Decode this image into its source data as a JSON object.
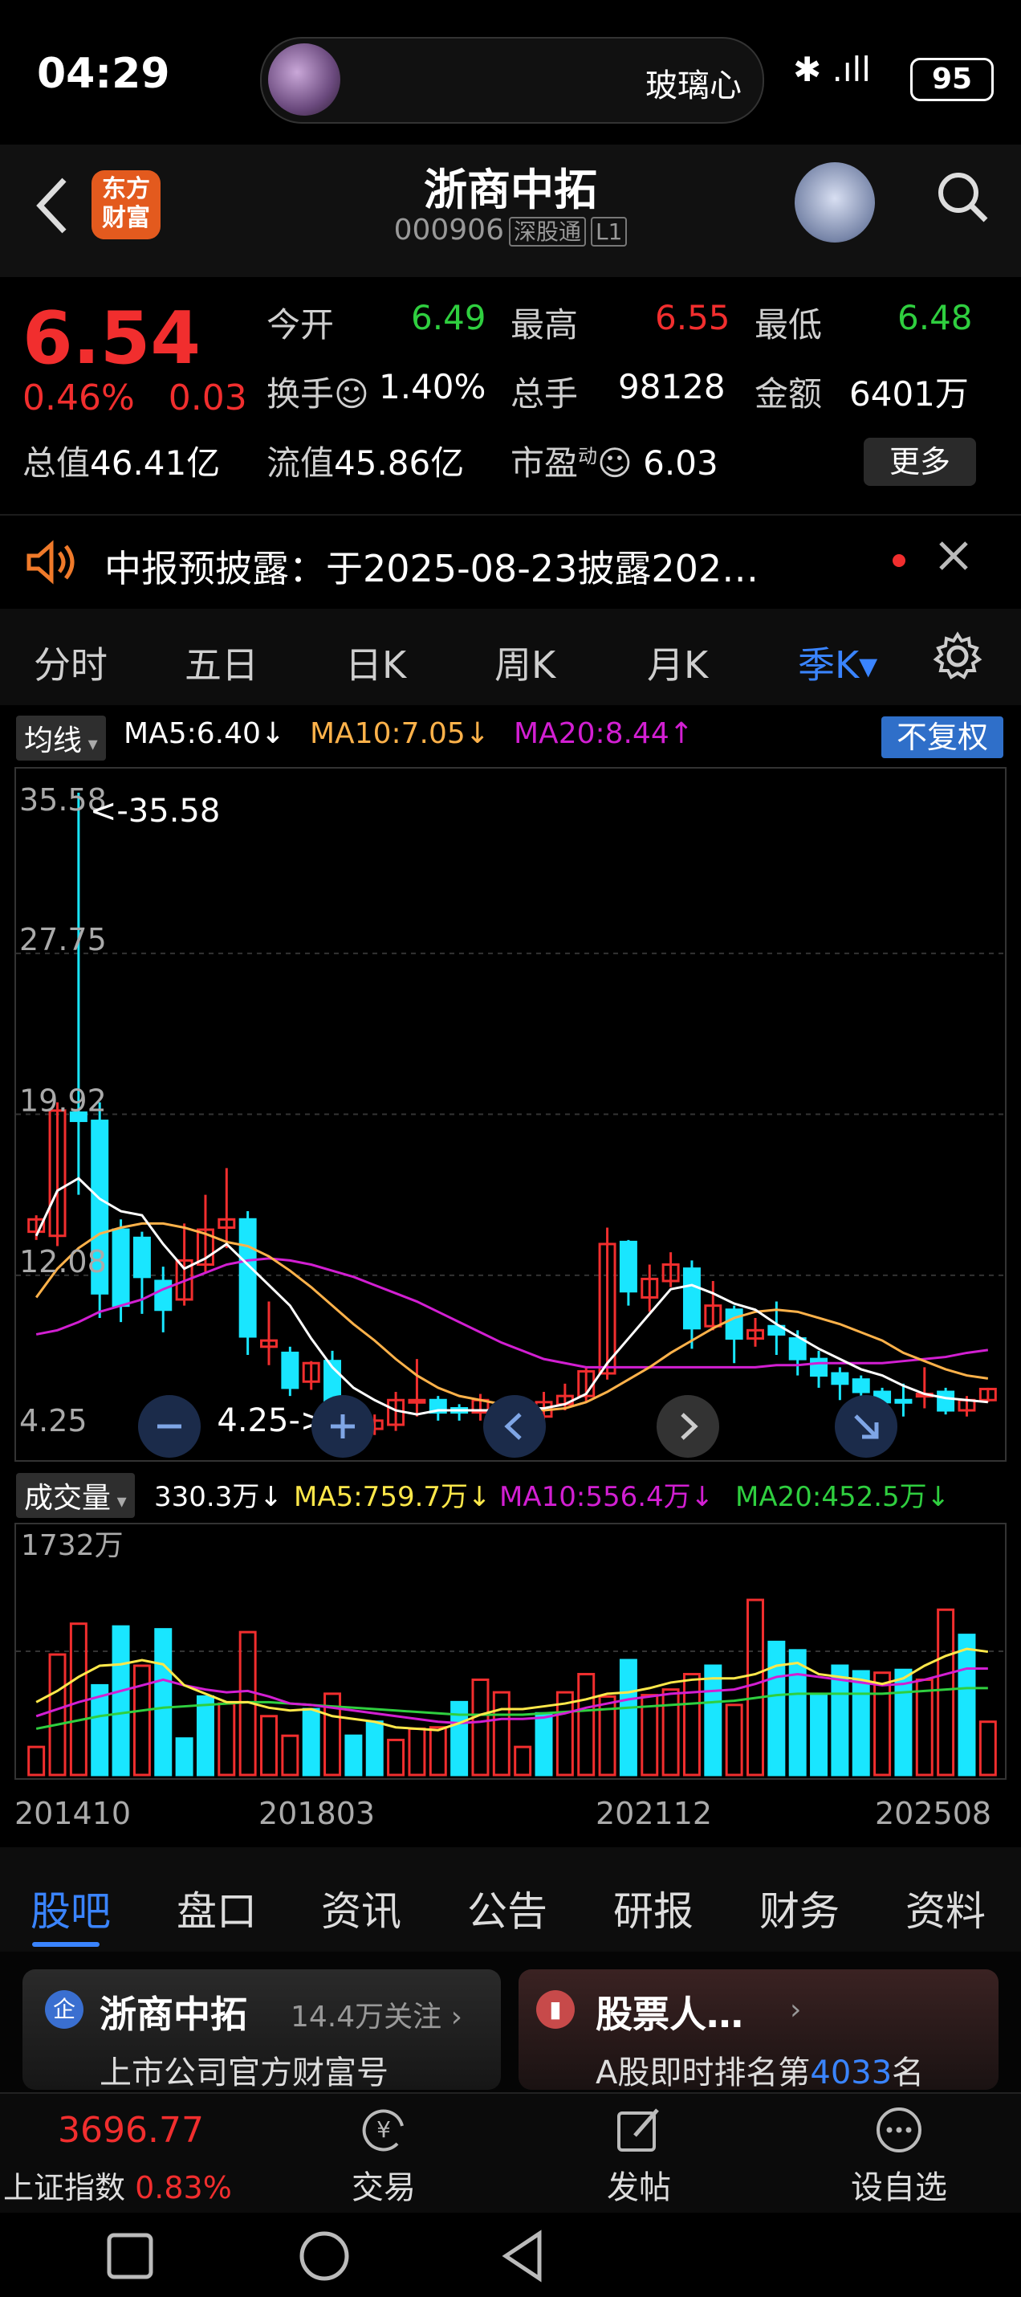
{
  "status_bar": {
    "time": "04:29",
    "island_text": "玻璃心",
    "signal_icons": "✱ .ıll",
    "battery": "95"
  },
  "header": {
    "back_icon": "chevron-left-icon",
    "logo_line1": "东方",
    "logo_line2": "财富",
    "stock_name": "浙商中拓",
    "stock_code": "000906",
    "exchange_tag": "深股通",
    "level_tag": "L1"
  },
  "quote": {
    "price": "6.54",
    "change_pct": "0.46%",
    "change_amt": "0.03",
    "open_label": "今开",
    "open": "6.49",
    "high_label": "最高",
    "high": "6.55",
    "low_label": "最低",
    "low": "6.48",
    "turnover_label": "换手",
    "turnover": "1.40%",
    "volume_label": "总手",
    "volume": "98128",
    "amount_label": "金额",
    "amount": "6401万",
    "total_cap_label": "总值",
    "total_cap": "46.41亿",
    "float_cap_label": "流值",
    "float_cap": "45.86亿",
    "pe_label": "市盈",
    "pe_sup": "动",
    "pe": "6.03",
    "more_button": "更多"
  },
  "notice": {
    "text": "中报预披露：于2025-08-23披露202…"
  },
  "kline_tabs": [
    "分时",
    "五日",
    "日K",
    "周K",
    "月K",
    "季K▾"
  ],
  "kline_active": 5,
  "ma_row": {
    "selector": "均线",
    "ma5": "MA5:6.40↓",
    "ma10": "MA10:7.05↓",
    "ma20": "MA20:8.44↑",
    "adjust": "不复权"
  },
  "chart_data": [
    {
      "type": "candlestick",
      "title": "",
      "y_ticks": [
        "35.58",
        "27.75",
        "19.92",
        "12.08",
        "4.25"
      ],
      "ylim": [
        4.25,
        35.58
      ],
      "max_label": "<-35.58",
      "min_label": "4.25->",
      "series_colors": {
        "up": "#f12e2e",
        "down": "#19e6ff",
        "ma5": "#ffffff",
        "ma10": "#ffb24a",
        "ma20": "#d21fd2"
      },
      "candles": [
        {
          "o": 14.2,
          "c": 14.8,
          "h": 15.0,
          "l": 13.8
        },
        {
          "o": 14.0,
          "c": 20.1,
          "h": 20.5,
          "l": 13.5
        },
        {
          "o": 20.0,
          "c": 19.6,
          "h": 35.58,
          "l": 16.0
        },
        {
          "o": 19.6,
          "c": 11.2,
          "h": 20.5,
          "l": 10.0
        },
        {
          "o": 14.3,
          "c": 10.6,
          "h": 14.8,
          "l": 9.8
        },
        {
          "o": 13.9,
          "c": 12.0,
          "h": 14.2,
          "l": 10.2
        },
        {
          "o": 11.8,
          "c": 10.4,
          "h": 12.5,
          "l": 9.3
        },
        {
          "o": 10.9,
          "c": 12.8,
          "h": 14.6,
          "l": 10.6
        },
        {
          "o": 12.6,
          "c": 14.3,
          "h": 16.0,
          "l": 12.2
        },
        {
          "o": 14.4,
          "c": 14.8,
          "h": 17.3,
          "l": 13.4
        },
        {
          "o": 14.8,
          "c": 9.1,
          "h": 15.2,
          "l": 8.2
        },
        {
          "o": 8.6,
          "c": 8.9,
          "h": 10.8,
          "l": 7.7
        },
        {
          "o": 8.3,
          "c": 6.6,
          "h": 8.6,
          "l": 6.2
        },
        {
          "o": 6.9,
          "c": 7.8,
          "h": 7.9,
          "l": 6.5
        },
        {
          "o": 7.9,
          "c": 5.0,
          "h": 8.4,
          "l": 4.6
        },
        {
          "o": 5.0,
          "c": 4.5,
          "h": 5.3,
          "l": 4.25
        },
        {
          "o": 4.6,
          "c": 5.0,
          "h": 5.3,
          "l": 4.3
        },
        {
          "o": 4.8,
          "c": 6.0,
          "h": 6.4,
          "l": 4.5
        },
        {
          "o": 6.0,
          "c": 6.0,
          "h": 8.0,
          "l": 5.2
        },
        {
          "o": 6.0,
          "c": 5.4,
          "h": 6.2,
          "l": 5.0
        },
        {
          "o": 5.6,
          "c": 5.4,
          "h": 5.8,
          "l": 5.0
        },
        {
          "o": 5.4,
          "c": 6.0,
          "h": 6.3,
          "l": 5.0
        },
        {
          "o": 5.5,
          "c": 4.7,
          "h": 5.7,
          "l": 4.5
        },
        {
          "o": 4.7,
          "c": 5.3,
          "h": 5.5,
          "l": 4.6
        },
        {
          "o": 5.2,
          "c": 5.9,
          "h": 6.4,
          "l": 5.0
        },
        {
          "o": 5.8,
          "c": 6.2,
          "h": 6.8,
          "l": 5.5
        },
        {
          "o": 6.2,
          "c": 7.4,
          "h": 7.6,
          "l": 5.9
        },
        {
          "o": 7.3,
          "c": 13.6,
          "h": 14.4,
          "l": 7.0
        },
        {
          "o": 13.7,
          "c": 11.3,
          "h": 13.8,
          "l": 10.6
        },
        {
          "o": 11.0,
          "c": 11.9,
          "h": 12.6,
          "l": 10.3
        },
        {
          "o": 11.8,
          "c": 12.6,
          "h": 13.2,
          "l": 11.5
        },
        {
          "o": 12.4,
          "c": 9.5,
          "h": 12.8,
          "l": 8.5
        },
        {
          "o": 9.6,
          "c": 10.6,
          "h": 11.8,
          "l": 9.4
        },
        {
          "o": 10.4,
          "c": 9.0,
          "h": 10.6,
          "l": 7.8
        },
        {
          "o": 9.0,
          "c": 9.4,
          "h": 10.0,
          "l": 8.6
        },
        {
          "o": 9.6,
          "c": 9.2,
          "h": 10.8,
          "l": 8.2
        },
        {
          "o": 9.0,
          "c": 8.0,
          "h": 9.4,
          "l": 7.2
        },
        {
          "o": 8.0,
          "c": 7.2,
          "h": 8.4,
          "l": 6.6
        },
        {
          "o": 7.3,
          "c": 6.8,
          "h": 7.6,
          "l": 6.0
        },
        {
          "o": 7.0,
          "c": 6.4,
          "h": 7.2,
          "l": 5.6
        },
        {
          "o": 6.4,
          "c": 5.9,
          "h": 6.6,
          "l": 4.25
        },
        {
          "o": 6.0,
          "c": 5.9,
          "h": 6.8,
          "l": 5.2
        },
        {
          "o": 6.2,
          "c": 6.3,
          "h": 7.6,
          "l": 5.6
        },
        {
          "o": 6.4,
          "c": 5.5,
          "h": 6.6,
          "l": 5.3
        },
        {
          "o": 5.5,
          "c": 6.0,
          "h": 6.2,
          "l": 5.2
        },
        {
          "o": 6.0,
          "c": 6.54,
          "h": 6.6,
          "l": 5.9
        }
      ],
      "ma5": [
        14.0,
        16.2,
        16.8,
        15.8,
        15.2,
        15.0,
        13.6,
        12.4,
        12.9,
        13.6,
        12.6,
        11.6,
        10.6,
        9.0,
        7.6,
        6.6,
        6.0,
        5.5,
        5.3,
        5.5,
        5.5,
        5.5,
        5.5,
        5.6,
        5.6,
        5.8,
        6.3,
        7.8,
        9.0,
        10.2,
        11.4,
        11.6,
        11.2,
        10.7,
        10.4,
        9.7,
        9.1,
        8.5,
        8.0,
        7.5,
        7.2,
        6.7,
        6.3,
        6.1,
        6.0,
        5.9
      ],
      "ma10": [
        11.0,
        12.4,
        13.4,
        14.1,
        14.4,
        14.6,
        14.6,
        14.4,
        14.1,
        13.7,
        13.5,
        13.0,
        12.3,
        11.5,
        10.6,
        9.7,
        8.9,
        8.0,
        7.2,
        6.6,
        6.2,
        6.0,
        5.8,
        5.6,
        5.5,
        5.6,
        5.9,
        6.4,
        7.0,
        7.6,
        8.3,
        8.9,
        9.5,
        10.0,
        10.3,
        10.4,
        10.3,
        10.0,
        9.7,
        9.3,
        8.9,
        8.3,
        7.9,
        7.5,
        7.2,
        7.05
      ],
      "ma20": [
        9.2,
        9.4,
        9.8,
        10.3,
        10.6,
        10.9,
        11.4,
        11.8,
        12.2,
        12.6,
        12.8,
        12.9,
        12.8,
        12.6,
        12.3,
        12.0,
        11.6,
        11.2,
        10.8,
        10.3,
        9.8,
        9.3,
        8.8,
        8.4,
        8.0,
        7.8,
        7.6,
        7.6,
        7.6,
        7.6,
        7.6,
        7.6,
        7.6,
        7.6,
        7.6,
        7.7,
        7.7,
        7.8,
        7.8,
        7.8,
        7.8,
        7.9,
        8.0,
        8.1,
        8.3,
        8.44
      ]
    },
    {
      "type": "bar",
      "title": "",
      "max_label": "1732万",
      "x_ticks": [
        "201410",
        "201803",
        "202112",
        "202508"
      ],
      "volumes_wan": [
        200,
        860,
        1080,
        640,
        1060,
        780,
        1040,
        260,
        560,
        510,
        1020,
        420,
        280,
        470,
        580,
        280,
        380,
        250,
        330,
        340,
        520,
        680,
        590,
        200,
        440,
        590,
        720,
        560,
        820,
        570,
        610,
        720,
        780,
        500,
        1250,
        950,
        890,
        570,
        780,
        740,
        730,
        750,
        680,
        1180,
        1000,
        380
      ],
      "up": [
        true,
        true,
        true,
        false,
        false,
        true,
        false,
        false,
        false,
        true,
        true,
        true,
        true,
        false,
        true,
        false,
        false,
        true,
        true,
        true,
        false,
        true,
        true,
        true,
        false,
        true,
        true,
        true,
        false,
        true,
        true,
        true,
        false,
        true,
        true,
        false,
        false,
        false,
        false,
        false,
        true,
        false,
        true,
        true,
        false,
        true
      ],
      "ma5": [
        520,
        600,
        700,
        780,
        790,
        820,
        790,
        640,
        580,
        520,
        520,
        480,
        460,
        470,
        420,
        400,
        380,
        340,
        330,
        320,
        370,
        430,
        470,
        470,
        490,
        510,
        540,
        580,
        590,
        620,
        660,
        680,
        690,
        690,
        720,
        780,
        800,
        720,
        700,
        680,
        650,
        690,
        780,
        850,
        900,
        880
      ],
      "ma10": [
        420,
        470,
        520,
        560,
        600,
        640,
        680,
        640,
        610,
        590,
        600,
        560,
        510,
        500,
        480,
        460,
        440,
        420,
        400,
        380,
        370,
        380,
        400,
        400,
        410,
        440,
        480,
        510,
        540,
        560,
        580,
        590,
        600,
        610,
        650,
        700,
        720,
        700,
        680,
        660,
        640,
        650,
        680,
        720,
        760,
        760
      ],
      "ma20": [
        330,
        360,
        390,
        420,
        440,
        460,
        480,
        490,
        500,
        510,
        520,
        520,
        510,
        500,
        490,
        480,
        470,
        460,
        450,
        440,
        430,
        430,
        430,
        430,
        440,
        450,
        460,
        470,
        480,
        490,
        500,
        510,
        520,
        530,
        550,
        570,
        580,
        580,
        580,
        580,
        580,
        590,
        600,
        610,
        620,
        620
      ],
      "colors": {
        "up": "#f12e2e",
        "down": "#19e6ff",
        "ma5": "#ffe84a",
        "ma10": "#d21fd2",
        "ma20": "#2fcf3f"
      }
    }
  ],
  "vol_row": {
    "selector": "成交量",
    "current": "330.3万↓",
    "ma5": "MA5:759.7万↓",
    "ma10": "MA10:556.4万↓",
    "ma20": "MA20:452.5万↓"
  },
  "bottom_tabs": [
    "股吧",
    "盘口",
    "资讯",
    "公告",
    "研报",
    "财务",
    "资料"
  ],
  "cards": [
    {
      "icon": "企",
      "title": "浙商中拓",
      "meta": "14.4万关注 ›",
      "subtitle": "上市公司官方财富号"
    },
    {
      "icon": "▮",
      "title": "股票人…",
      "meta": "›",
      "subtitle_pre": "A股即时排名第",
      "rank": "4033",
      "subtitle_post": "名"
    }
  ],
  "fund_bar": {
    "index_value": "3696.77",
    "index_name": "上证指数",
    "index_change": "0.83%",
    "trade_label": "交易",
    "post_label": "发帖",
    "watch_label": "设自选"
  }
}
